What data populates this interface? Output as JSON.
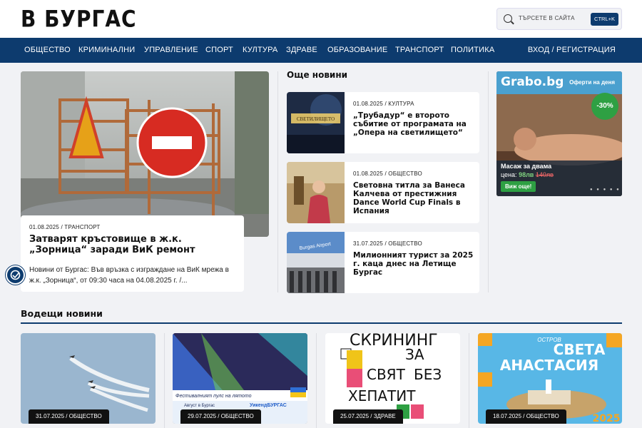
{
  "header": {
    "logo": "В БУРГАС",
    "search_placeholder": "ТЪРСЕТЕ В САЙТА",
    "search_shortcut": "CTRL+K"
  },
  "nav": {
    "items": [
      "ОБЩЕСТВО",
      "КРИМИНАЛНИ",
      "УПРАВЛЕНИЕ",
      "СПОРТ",
      "КУЛТУРА",
      "ЗДРАВЕ",
      "ОБРАЗОВАНИЕ",
      "ТРАНСПОРТ",
      "ПОЛИТИКА"
    ],
    "login": "ВХОД / РЕГИСТРАЦИЯ"
  },
  "hero": {
    "meta": "01.08.2025 / ТРАНСПОРТ",
    "title": "Затварят кръстовище в ж.к. „Зорница“ заради ВиК ремонт",
    "excerpt": "Новини от Бургас: Във връзка с изграждане на ВиК мрежа в ж.к. „Зорница“, от 09:30 часа на 04.08.2025 г. /..."
  },
  "more": {
    "title": "Още новини",
    "items": [
      {
        "meta": "01.08.2025 / КУЛТУРА",
        "title": "„Трубадур“ е второто събитие от програмата на „Опера на светилището“",
        "thumb_text": "СВЕТИЛИЩЕТО"
      },
      {
        "meta": "01.08.2025 / ОБЩЕСТВО",
        "title": "Световна титла за Ванеса Калчева от престижния Dance World Cup Finals в Испания"
      },
      {
        "meta": "31.07.2025 / ОБЩЕСТВО",
        "title": "Милионният турист за 2025 г. каца днес на Летище Бургас",
        "thumb_text": "Burgas Airport"
      }
    ]
  },
  "ad": {
    "logo": "Grabo.bg",
    "offers": "Оферти на деня",
    "discount": "-30%",
    "title": "Масаж за двама",
    "price_label": "цена:",
    "price_new": "98лв",
    "price_old": "140лв",
    "cta": "Виж още!"
  },
  "leading": {
    "title": "Водещи новини",
    "items": [
      {
        "meta": "31.07.2025 / ОБЩЕСТВО"
      },
      {
        "meta": "29.07.2025 / ОБЩЕСТВО",
        "caption": "Фестивалният пулс на лятото",
        "sub1": "Август в Бургас",
        "sub2": "УикендБУРГАС"
      },
      {
        "meta": "25.07.2025 / ЗДРАВЕ",
        "l1": "СКРИНИНГ",
        "l2": "ЗА",
        "l3": "СВЯТ",
        "l4": "БЕЗ",
        "l5": "ХЕПАТИТ"
      },
      {
        "meta": "18.07.2025 / ОБЩЕСТВО",
        "t1": "ОСТРОВ",
        "t2": "СВЕТА",
        "t3": "АНАСТАСИЯ",
        "year": "2025"
      }
    ]
  }
}
